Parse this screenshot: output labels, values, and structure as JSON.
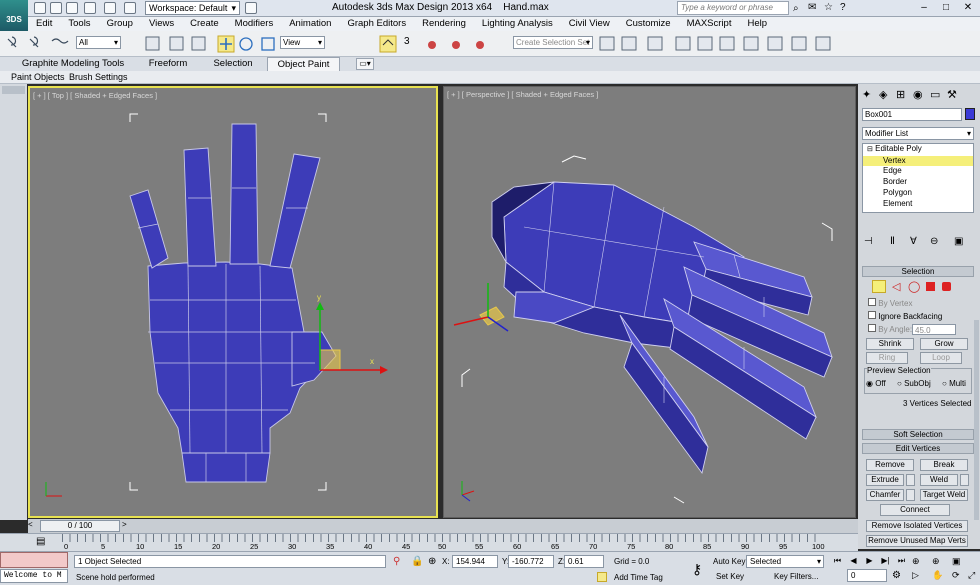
{
  "titlebar": {
    "logo_text": "3DS",
    "workspace": "Workspace: Default",
    "app_title": "Autodesk 3ds Max Design 2013 x64",
    "file_name": "Hand.max",
    "search_placeholder": "Type a keyword or phrase"
  },
  "menu": [
    "Edit",
    "Tools",
    "Group",
    "Views",
    "Create",
    "Modifiers",
    "Animation",
    "Graph Editors",
    "Rendering",
    "Lighting Analysis",
    "Civil View",
    "Customize",
    "MAXScript",
    "Help"
  ],
  "toolbar": {
    "selection_filter": "All",
    "ref_coord": "View",
    "snap_value": "3",
    "named_selection_placeholder": "Create Selection Set"
  },
  "ribbon": {
    "tabs": [
      "Graphite Modeling Tools",
      "Freeform",
      "Selection",
      "Object Paint"
    ],
    "active_tab": "Object Paint",
    "subtabs": [
      "Paint Objects",
      "Brush Settings"
    ]
  },
  "viewports": {
    "top_label": "[ + ] [ Top ] [ Shaded + Edged Faces ]",
    "persp_label": "[ + ] [ Perspective ] [ Shaded + Edged Faces ]",
    "axis_x": "x",
    "axis_y": "y",
    "axis_z": "z",
    "mesh_color": "#3d3cb8",
    "active_border": "#e8e251"
  },
  "command_panel": {
    "object_name": "Box001",
    "object_color": "#3b3bd6",
    "modifier_list": "Modifier List",
    "stack": [
      "Editable Poly",
      "Vertex",
      "Edge",
      "Border",
      "Polygon",
      "Element"
    ],
    "selected_stack_item": "Vertex",
    "selection_header": "Selection",
    "by_vertex": "By Vertex",
    "ignore_backfacing": "Ignore Backfacing",
    "by_angle": "By Angle:",
    "by_angle_value": "45.0",
    "shrink": "Shrink",
    "grow": "Grow",
    "ring": "Ring",
    "loop": "Loop",
    "preview_selection": "Preview Selection",
    "preview_off": "Off",
    "preview_subobj": "SubObj",
    "preview_multi": "Multi",
    "selected_count": "3 Vertices Selected",
    "soft_selection": "Soft Selection",
    "edit_vertices": "Edit Vertices",
    "remove": "Remove",
    "break": "Break",
    "extrude": "Extrude",
    "weld": "Weld",
    "chamfer": "Chamfer",
    "target_weld": "Target Weld",
    "connect": "Connect",
    "remove_isolated": "Remove Isolated Vertices",
    "remove_unused": "Remove Unused Map Verts"
  },
  "timeline": {
    "frame_display": "0 / 100",
    "ticks": [
      "0",
      "5",
      "10",
      "15",
      "20",
      "25",
      "30",
      "35",
      "40",
      "45",
      "50",
      "55",
      "60",
      "65",
      "70",
      "75",
      "80",
      "85",
      "90",
      "95",
      "100"
    ]
  },
  "status": {
    "welcome": "Welcome to M",
    "objects_selected": "1 Object Selected",
    "prompt": "Scene hold performed",
    "x_label": "X:",
    "x_value": "154.944",
    "y_label": "Y:",
    "y_value": "-160.772",
    "z_label": "Z:",
    "z_value": "0.61",
    "grid": "Grid = 0.0",
    "add_time_tag": "Add Time Tag",
    "auto_key": "Auto Key",
    "set_key": "Set Key",
    "key_mode": "Selected",
    "key_filters": "Key Filters...",
    "current_frame": "0"
  }
}
